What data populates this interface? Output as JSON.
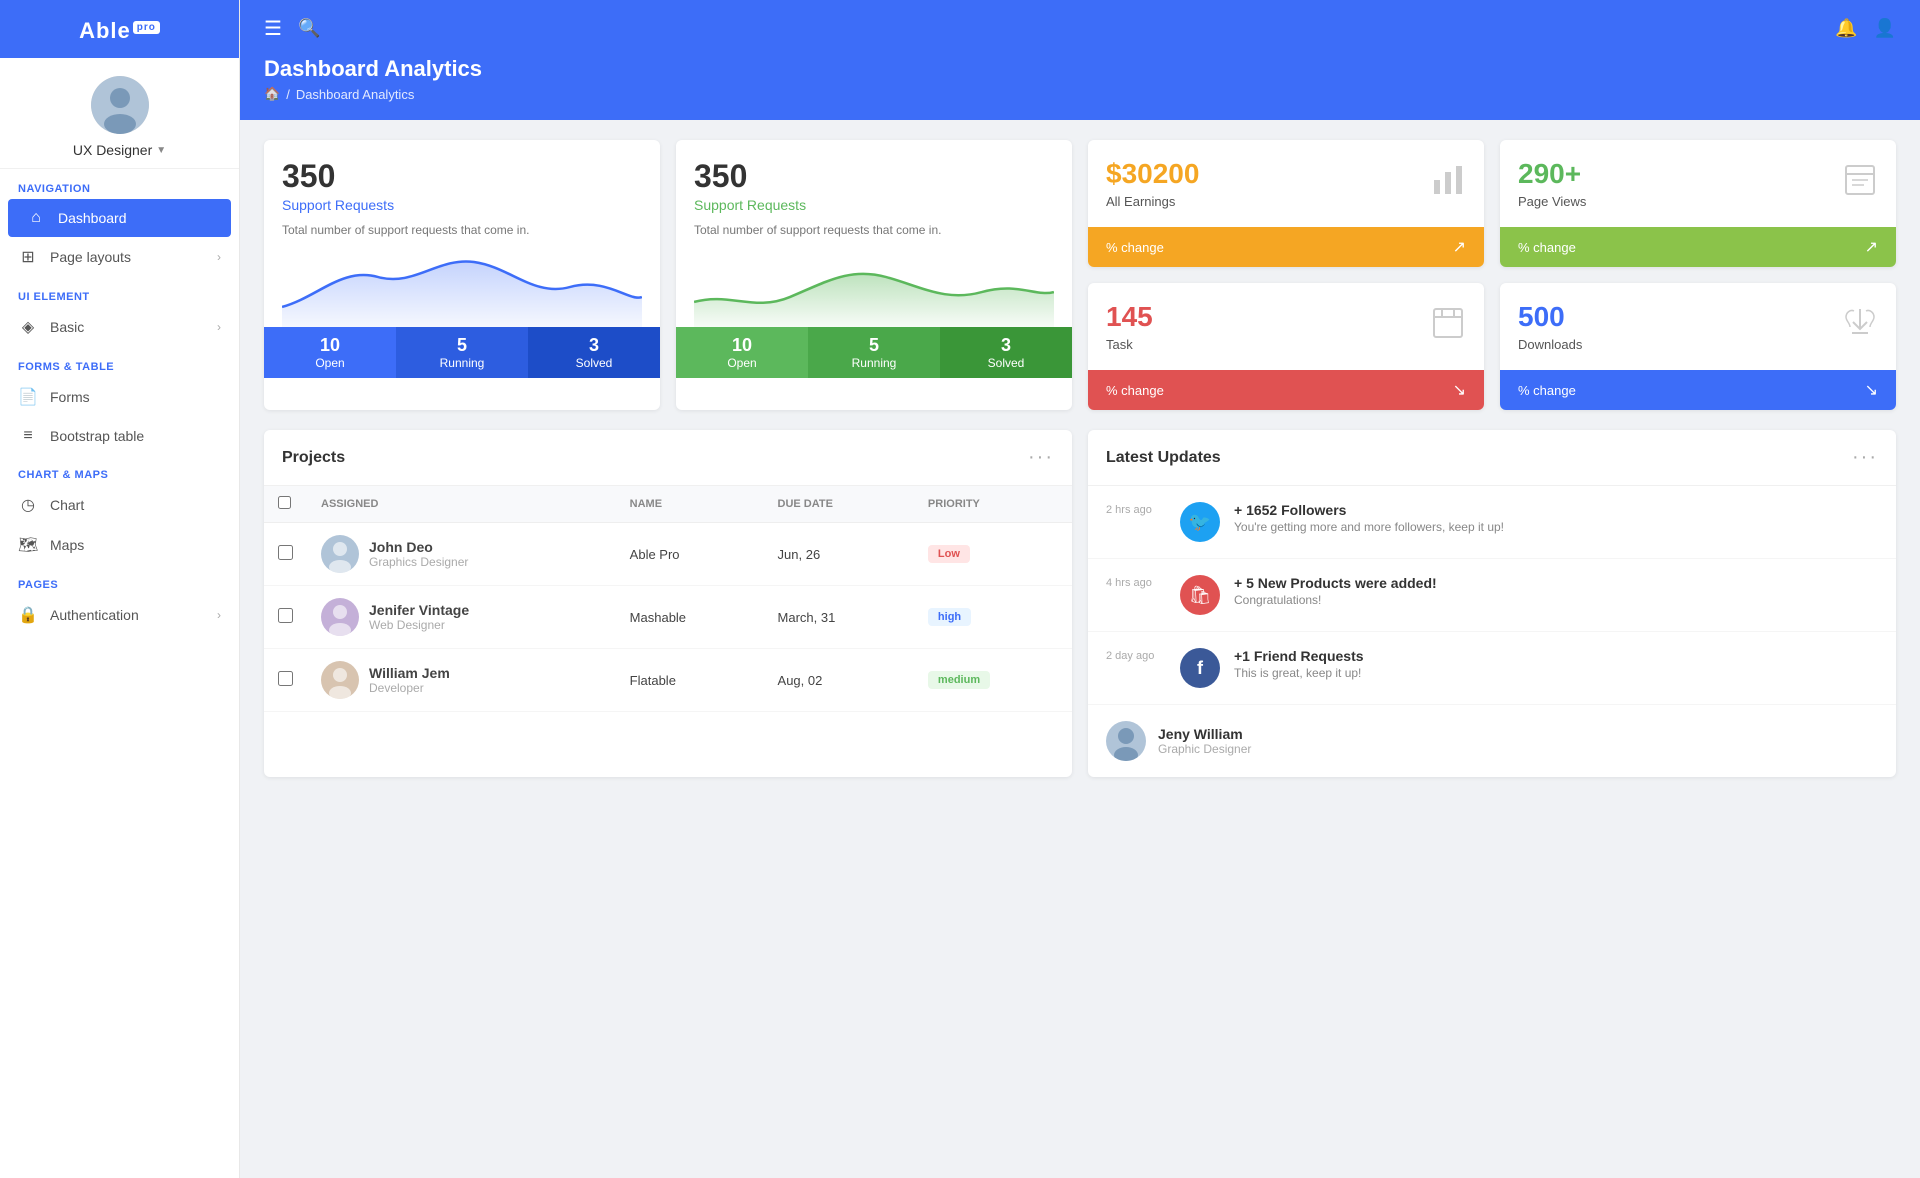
{
  "sidebar": {
    "logo": "Able",
    "logo_pro": "pro",
    "user": {
      "name": "UX Designer",
      "caret": "▼"
    },
    "sections": [
      {
        "label": "Navigation",
        "items": [
          {
            "id": "dashboard",
            "label": "Dashboard",
            "icon": "⌂",
            "active": true
          },
          {
            "id": "page-layouts",
            "label": "Page layouts",
            "icon": "⊞",
            "arrow": "›"
          }
        ]
      },
      {
        "label": "UI Element",
        "items": [
          {
            "id": "basic",
            "label": "Basic",
            "icon": "◈",
            "arrow": "›"
          }
        ]
      },
      {
        "label": "Forms & Table",
        "items": [
          {
            "id": "forms",
            "label": "Forms",
            "icon": "📄"
          },
          {
            "id": "bootstrap-table",
            "label": "Bootstrap table",
            "icon": "≡"
          }
        ]
      },
      {
        "label": "Chart & Maps",
        "items": [
          {
            "id": "chart",
            "label": "Chart",
            "icon": "◷"
          },
          {
            "id": "maps",
            "label": "Maps",
            "icon": "🗺"
          }
        ]
      },
      {
        "label": "Pages",
        "items": [
          {
            "id": "authentication",
            "label": "Authentication",
            "icon": "🔒",
            "arrow": "›"
          }
        ]
      }
    ]
  },
  "header": {
    "title": "Dashboard Analytics",
    "breadcrumb": [
      "🏠",
      "/",
      "Dashboard Analytics"
    ]
  },
  "stat_cards": [
    {
      "id": "support-blue",
      "number": "350",
      "title": "Support Requests",
      "title_color": "blue",
      "desc": "Total number of support requests that come in.",
      "footer_color": "blue",
      "footer_items": [
        {
          "num": "10",
          "label": "Open"
        },
        {
          "num": "5",
          "label": "Running"
        },
        {
          "num": "3",
          "label": "Solved"
        }
      ]
    },
    {
      "id": "support-green",
      "number": "350",
      "title": "Support Requests",
      "title_color": "green",
      "desc": "Total number of support requests that come in.",
      "footer_color": "green",
      "footer_items": [
        {
          "num": "10",
          "label": "Open"
        },
        {
          "num": "5",
          "label": "Running"
        },
        {
          "num": "3",
          "label": "Solved"
        }
      ]
    }
  ],
  "compact_cards": [
    {
      "id": "earnings",
      "number": "$30200",
      "number_color": "orange",
      "label": "All Earnings",
      "icon": "📊",
      "footer_label": "% change",
      "footer_color": "orange",
      "trend": "↗"
    },
    {
      "id": "page-views",
      "number": "290+",
      "number_color": "green",
      "label": "Page Views",
      "icon": "📋",
      "footer_label": "% change",
      "footer_color": "green-light",
      "trend": "↗"
    },
    {
      "id": "task",
      "number": "145",
      "number_color": "red",
      "label": "Task",
      "icon": "📅",
      "footer_label": "% change",
      "footer_color": "red",
      "trend": "↘"
    },
    {
      "id": "downloads",
      "number": "500",
      "number_color": "blue-dark",
      "label": "Downloads",
      "icon": "👎",
      "footer_label": "% change",
      "footer_color": "blue-dark",
      "trend": "↘"
    }
  ],
  "projects": {
    "title": "Projects",
    "columns": [
      "ASSIGNED",
      "NAME",
      "DUE DATE",
      "PRIORITY"
    ],
    "rows": [
      {
        "name": "John Deo",
        "role": "Graphics Designer",
        "project": "Able Pro",
        "due": "Jun, 26",
        "priority": "Low",
        "priority_class": "priority-low"
      },
      {
        "name": "Jenifer Vintage",
        "role": "Web Designer",
        "project": "Mashable",
        "due": "March, 31",
        "priority": "high",
        "priority_class": "priority-high"
      },
      {
        "name": "William Jem",
        "role": "Developer",
        "project": "Flatable",
        "due": "Aug, 02",
        "priority": "medium",
        "priority_class": "priority-medium"
      }
    ]
  },
  "updates": {
    "title": "Latest Updates",
    "items": [
      {
        "time": "2 hrs ago",
        "icon_type": "twitter",
        "icon": "🐦",
        "title": "+ 1652 Followers",
        "desc": "You're getting more and more followers, keep it up!"
      },
      {
        "time": "4 hrs ago",
        "icon_type": "product",
        "icon": "🛍",
        "title": "+ 5 New Products were added!",
        "desc": "Congratulations!"
      },
      {
        "time": "2 day ago",
        "icon_type": "facebook",
        "icon": "f",
        "title": "+1 Friend Requests",
        "desc": "This is great, keep it up!"
      },
      {
        "time": "",
        "user_name": "Jeny William",
        "user_role": "Graphic Designer"
      }
    ]
  }
}
